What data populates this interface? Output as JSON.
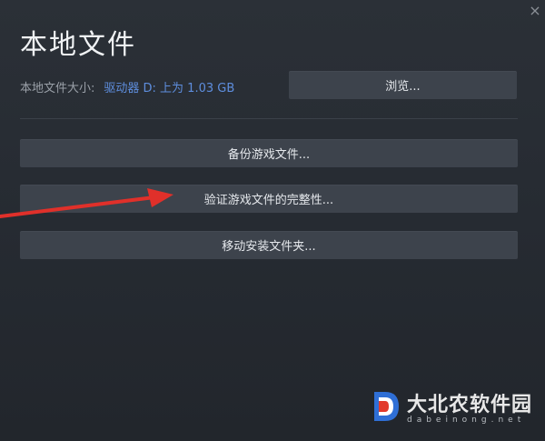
{
  "window": {
    "close_glyph": "×"
  },
  "header": {
    "title": "本地文件"
  },
  "local_size": {
    "label": "本地文件大小:",
    "value": "驱动器 D: 上为 1.03 GB"
  },
  "buttons": {
    "browse": "浏览...",
    "backup": "备份游戏文件...",
    "verify": "验证游戏文件的完整性...",
    "move": "移动安装文件夹..."
  },
  "annotation": {
    "arrow_color": "#e0302a"
  },
  "watermark": {
    "logo_letter": "D",
    "text": "大北农软件园",
    "sub": "dabeinong.net"
  },
  "colors": {
    "accent_link": "#5e8ede",
    "button_bg": "#3d434c",
    "background": "#262b32"
  }
}
